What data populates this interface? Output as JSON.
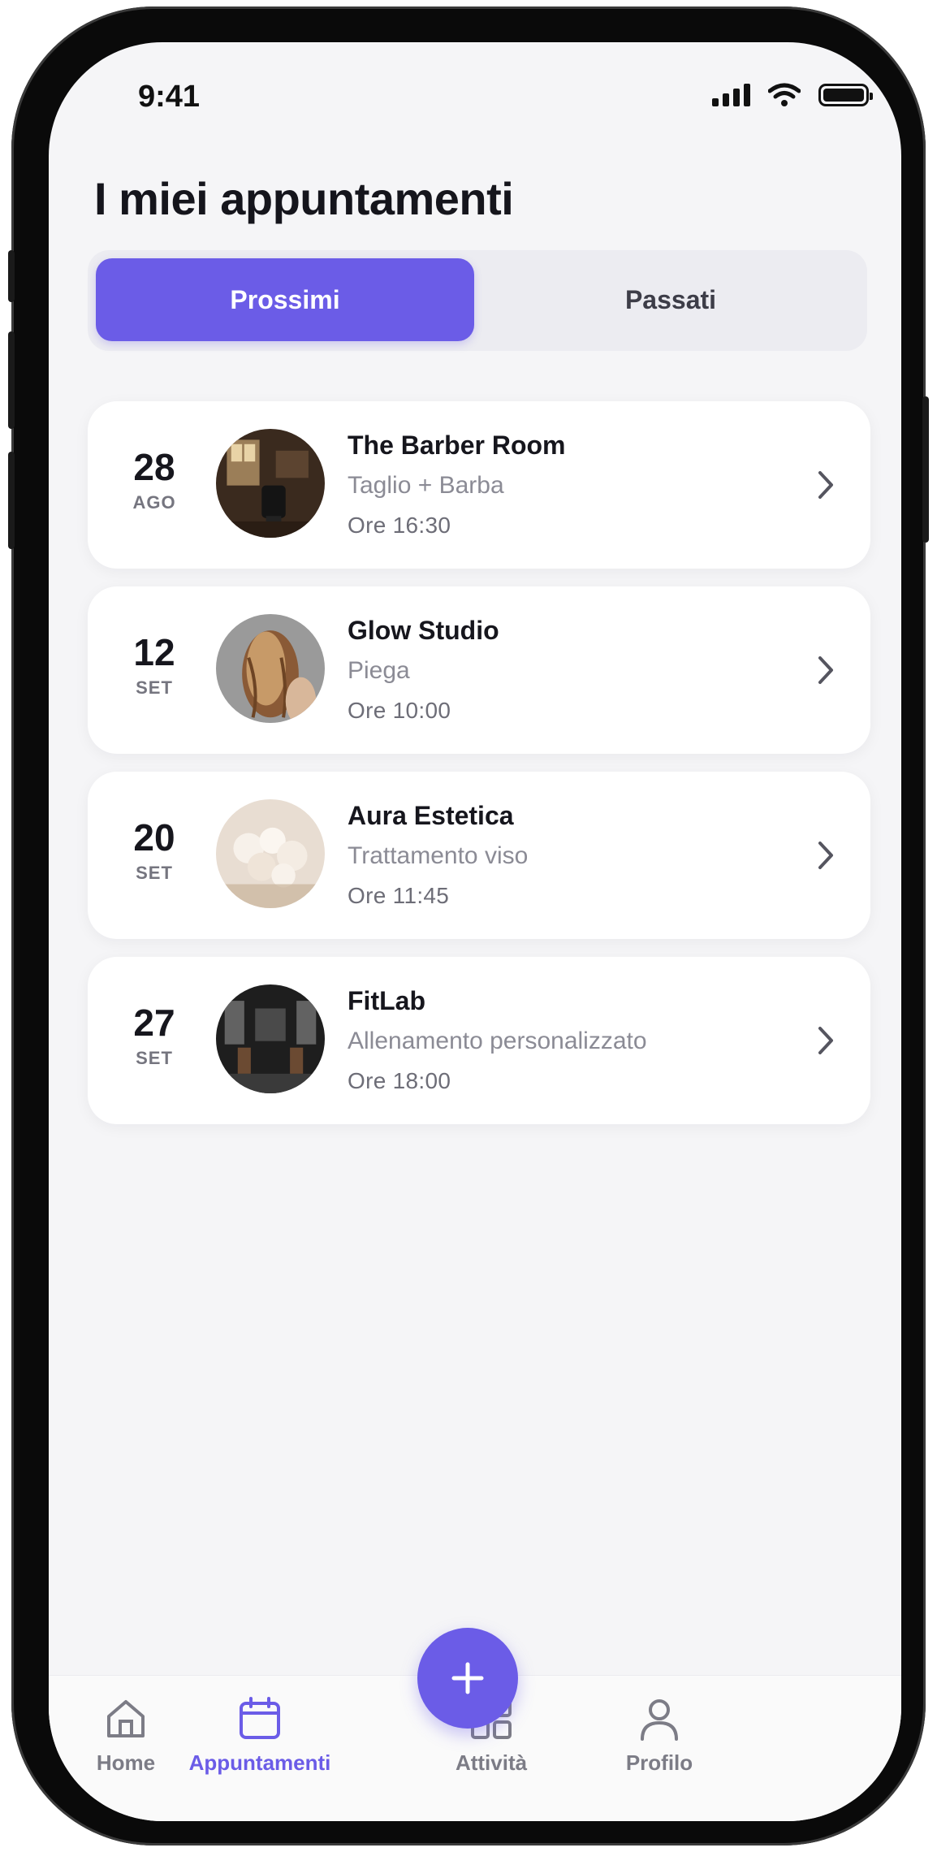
{
  "status_bar": {
    "time": "9:41"
  },
  "header": {
    "title": "I miei appuntamenti"
  },
  "segment": {
    "upcoming_label": "Prossimi",
    "past_label": "Passati",
    "active": "Prossimi"
  },
  "appointments": [
    {
      "day": "28",
      "month": "AGO",
      "name": "The Barber Room",
      "service": "Taglio + Barba",
      "time": "Ore 16:30"
    },
    {
      "day": "12",
      "month": "SET",
      "name": "Glow Studio",
      "service": "Piega",
      "time": "Ore 10:00"
    },
    {
      "day": "20",
      "month": "SET",
      "name": "Aura Estetica",
      "service": "Trattamento viso",
      "time": "Ore 11:45"
    },
    {
      "day": "27",
      "month": "SET",
      "name": "FitLab",
      "service": "Allenamento personalizzato",
      "time": "Ore 18:00"
    }
  ],
  "tab_bar": {
    "items": [
      {
        "label": "Home",
        "icon": "home-icon"
      },
      {
        "label": "Appuntamenti",
        "icon": "calendar-icon"
      },
      {
        "label": "Attività",
        "icon": "grid-icon"
      },
      {
        "label": "Profilo",
        "icon": "person-icon"
      }
    ],
    "active": "Appuntamenti",
    "fab_icon": "plus-icon"
  },
  "colors": {
    "accent": "#6b5ce7",
    "background": "#f5f5f7",
    "card": "#ffffff",
    "text": "#16161d",
    "muted": "#8b8b95"
  }
}
